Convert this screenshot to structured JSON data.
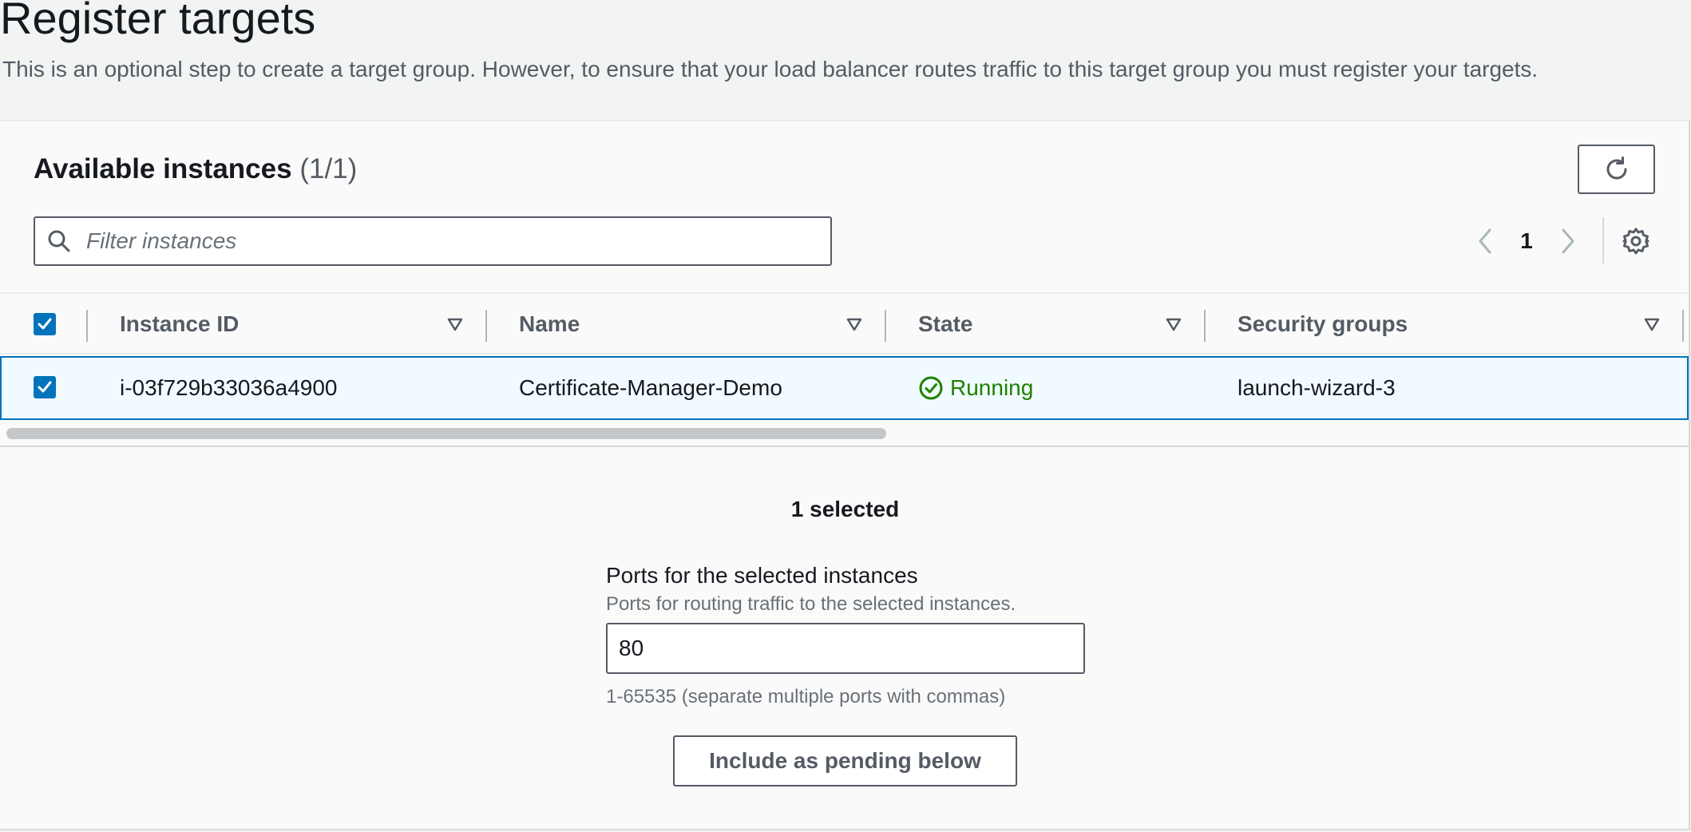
{
  "header": {
    "title": "Register targets",
    "description": "This is an optional step to create a target group. However, to ensure that your load balancer routes traffic to this target group you must register your targets."
  },
  "instances_panel": {
    "title": "Available instances",
    "count": "(1/1)",
    "refresh_icon": "refresh-icon",
    "search": {
      "placeholder": "Filter instances",
      "value": ""
    },
    "pagination": {
      "current_page": "1",
      "prev_icon": "chevron-left-icon",
      "next_icon": "chevron-right-icon"
    },
    "settings_icon": "gear-icon",
    "table": {
      "columns": [
        "Instance ID",
        "Name",
        "State",
        "Security groups"
      ],
      "rows": [
        {
          "selected": true,
          "instance_id": "i-03f729b33036a4900",
          "name": "Certificate-Manager-Demo",
          "state": "Running",
          "security_groups": "launch-wizard-3"
        }
      ],
      "scroll_fraction": 0.52
    }
  },
  "selection": {
    "selected_text": "1 selected",
    "ports_label": "Ports for the selected instances",
    "ports_description": "Ports for routing traffic to the selected instances.",
    "ports_value": "80",
    "ports_hint": "1-65535 (separate multiple ports with commas)",
    "include_button": "Include as pending below"
  },
  "colors": {
    "accent": "#0073bb",
    "running": "#1d8102",
    "text": "#16191f",
    "muted": "#545b64"
  }
}
